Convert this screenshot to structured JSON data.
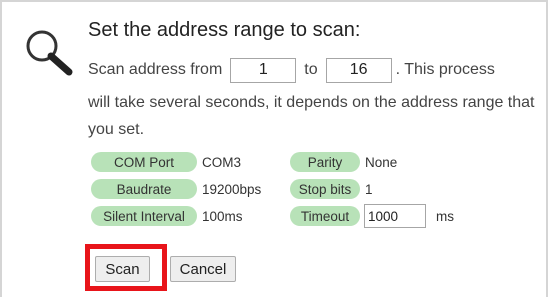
{
  "scan_dialog": {
    "heading": "Set the address range to scan:",
    "from_label": "Scan address from",
    "from_value": "1",
    "to_label": "to",
    "to_value": "16",
    "tail_text": ". This process",
    "description": "will take several seconds, it depends on the address range that you set."
  },
  "settings": {
    "com_port": {
      "label": "COM Port",
      "value": "COM3"
    },
    "parity": {
      "label": "Parity",
      "value": "None"
    },
    "baudrate": {
      "label": "Baudrate",
      "value": "19200bps"
    },
    "stop_bits": {
      "label": "Stop bits",
      "value": "1"
    },
    "silent_interval": {
      "label": "Silent Interval",
      "value": "100ms"
    },
    "timeout": {
      "label": "Timeout",
      "value": "1000",
      "unit": "ms"
    }
  },
  "buttons": {
    "scan_label": "Scan",
    "cancel_label": "Cancel"
  },
  "icons": {
    "search": "search-icon"
  },
  "colors": {
    "pill_background": "#b8e2b8",
    "highlight_border": "#e8141a"
  }
}
